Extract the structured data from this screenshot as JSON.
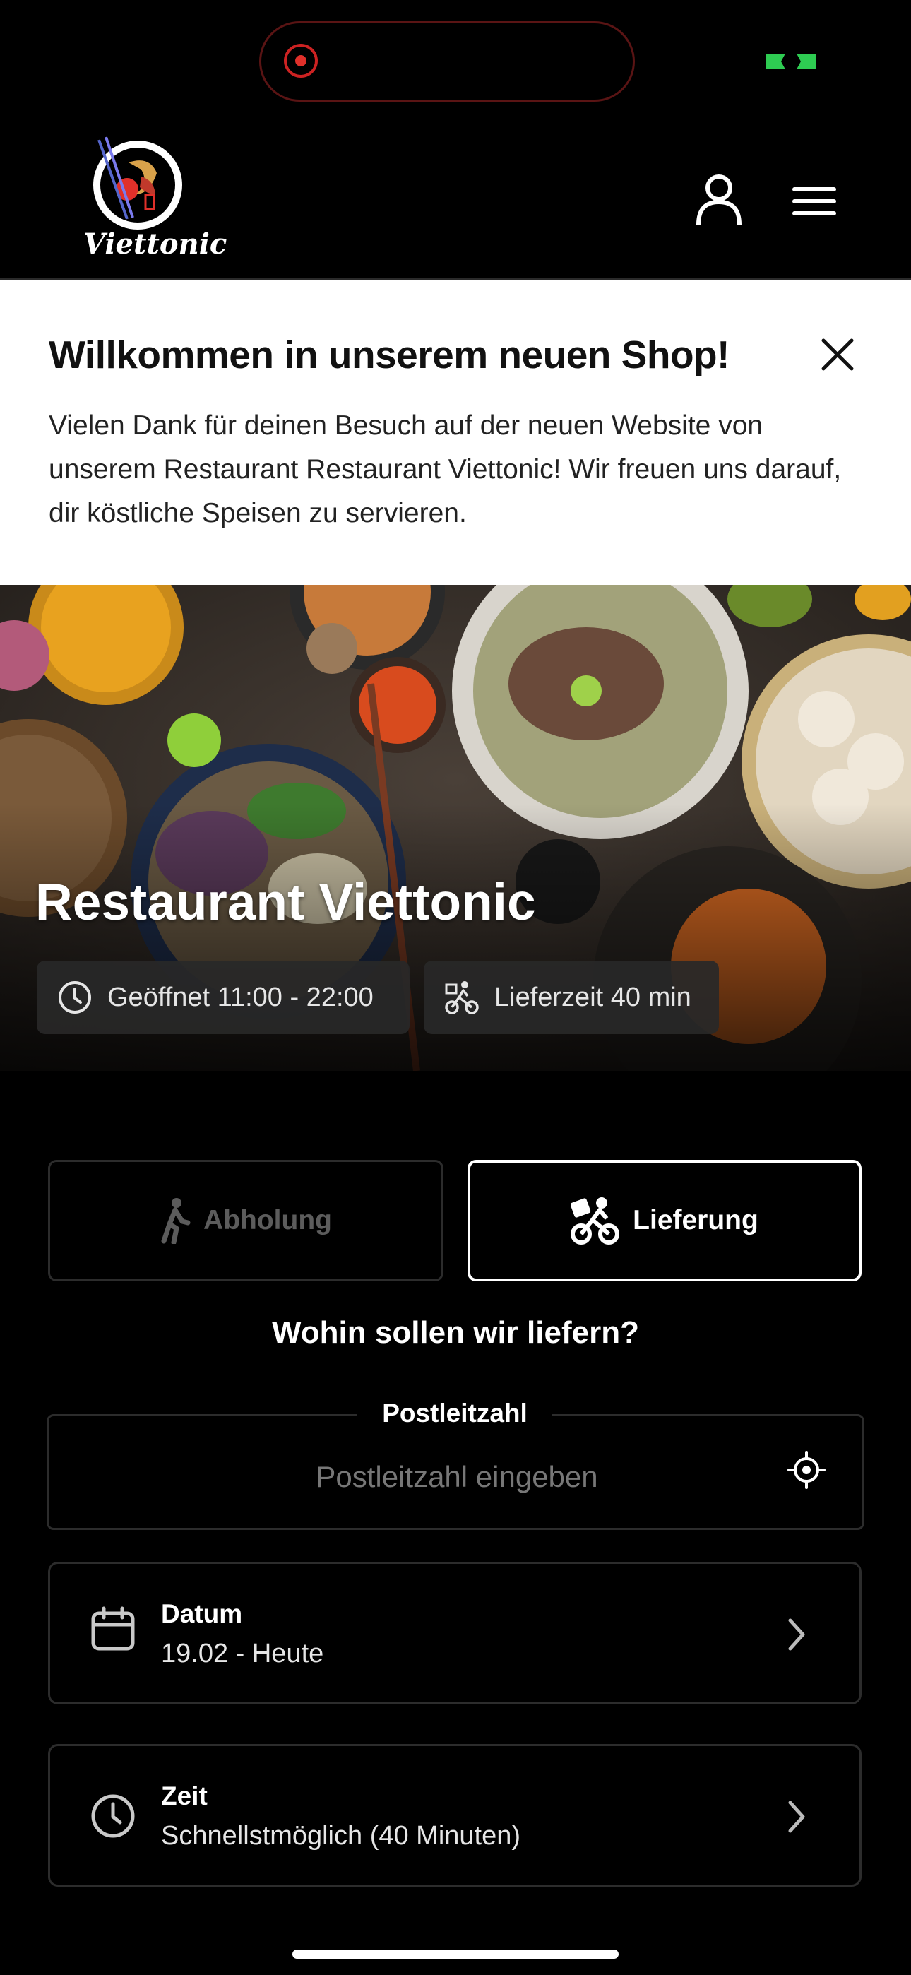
{
  "app": {
    "logo_text": "Viettonic",
    "brand_colors": {
      "background": "#000000",
      "accent_red": "#e0302a",
      "status_green": "#2ecc52"
    }
  },
  "banner": {
    "title": "Willkommen in unserem neuen Shop!",
    "text": "Vielen Dank für deinen Besuch auf der neuen Website von unserem Restaurant Restaurant Viettonic! Wir freuen uns darauf, dir köstliche Speisen zu servieren."
  },
  "hero": {
    "title": "Restaurant Viettonic",
    "hours": "Geöffnet 11:00 - 22:00",
    "delivery_time": "Lieferzeit 40 min"
  },
  "mode": {
    "pickup_label": "Abholung",
    "delivery_label": "Lieferung",
    "selected": "Lieferung"
  },
  "delivery": {
    "question": "Wohin sollen wir liefern?",
    "postal_label": "Postleitzahl",
    "postal_placeholder": "Postleitzahl eingeben",
    "postal_value": ""
  },
  "date": {
    "title": "Datum",
    "value": "19.02 - Heute"
  },
  "time": {
    "title": "Zeit",
    "value": "Schnellstmöglich (40 Minuten)"
  },
  "icons": {
    "header": [
      "user-icon",
      "menu-icon"
    ],
    "banner": [
      "close-icon"
    ],
    "chips": [
      "clock-icon",
      "bike-courier-icon"
    ],
    "modes": [
      "walking-icon",
      "bike-courier-icon"
    ],
    "postal": [
      "locate-icon"
    ],
    "cards": [
      "calendar-icon",
      "clock-icon",
      "chevron-right-icon"
    ]
  }
}
